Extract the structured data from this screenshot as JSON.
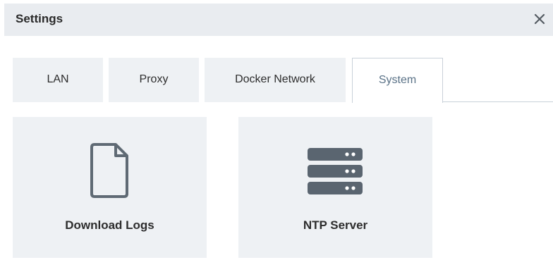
{
  "header": {
    "title": "Settings",
    "close_icon": "close-icon"
  },
  "tabs": [
    {
      "label": "LAN",
      "active": false
    },
    {
      "label": "Proxy",
      "active": false
    },
    {
      "label": "Docker Network",
      "active": false
    },
    {
      "label": "System",
      "active": true
    }
  ],
  "cards": [
    {
      "label": "Download Logs",
      "icon": "document-icon"
    },
    {
      "label": "NTP Server",
      "icon": "server-icon"
    }
  ],
  "colors": {
    "header_bg": "#e9ecf0",
    "tab_bg": "#eef1f4",
    "active_tab_text": "#5a7287",
    "icon_outline": "#5f6a74",
    "server_icon": "#5a6570"
  }
}
